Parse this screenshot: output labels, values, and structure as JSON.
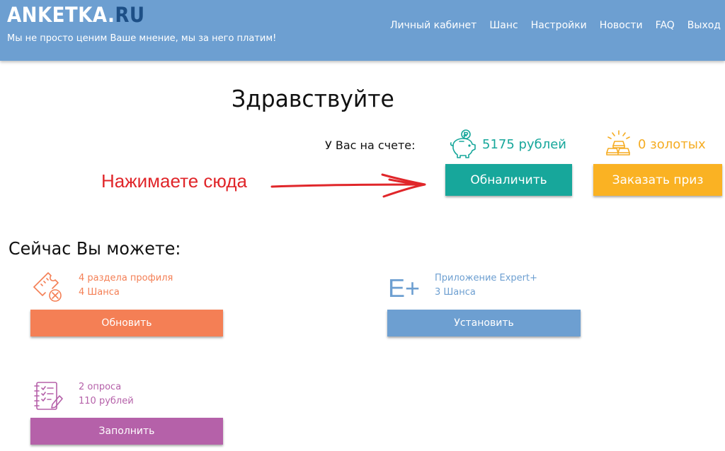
{
  "header": {
    "logo_main": "ANKETKA.",
    "logo_suffix": "RU",
    "tagline": "Мы не просто ценим Ваше мнение, мы за него платим!",
    "nav": [
      "Личный кабинет",
      "Шанс",
      "Настройки",
      "Новости",
      "FAQ",
      "Выход"
    ]
  },
  "main": {
    "greeting": "Здравствуйте",
    "balance_label": "У Вас на счете:",
    "rubles": "5175 рублей",
    "gold": "0 золотых",
    "cash_button": "Обналичить",
    "prize_button": "Заказать приз",
    "hint": "Нажимаете сюда",
    "can_title": "Сейчас Вы можете:"
  },
  "tasks": [
    {
      "title": "4 раздела профиля",
      "reward": "4 Шанса",
      "button": "Обновить",
      "icon": "ticket-cancel-icon"
    },
    {
      "title": "Приложение Expert+",
      "reward": "3 Шанса",
      "button": "Установить",
      "icon": "expert-plus-icon",
      "icon_text": "E+"
    },
    {
      "title": "2 опроса",
      "reward": "110 рублей",
      "button": "Заполнить",
      "icon": "checklist-icon"
    }
  ],
  "colors": {
    "header": "#6d9fd1",
    "teal": "#17a79b",
    "orange": "#fab223",
    "coral": "#f47f55",
    "purple": "#b561a9",
    "hint_red": "#e0262a"
  }
}
